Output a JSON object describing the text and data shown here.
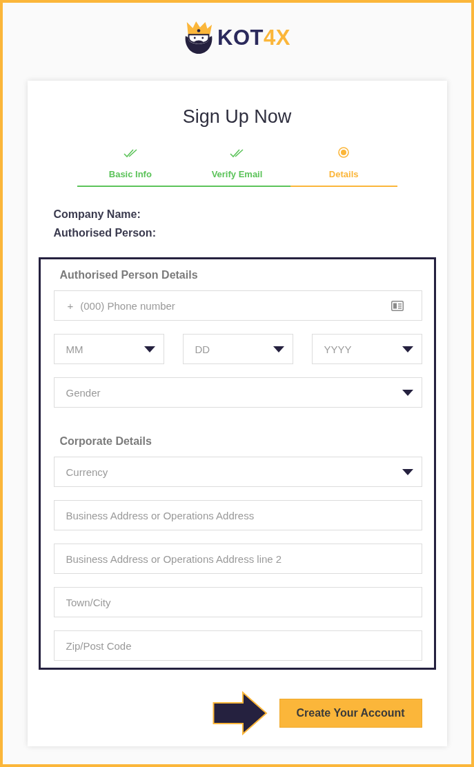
{
  "logo": {
    "text": "KOT",
    "accent": "4X"
  },
  "title": "Sign Up Now",
  "steps": [
    {
      "label": "Basic Info",
      "completed": true,
      "selected": false
    },
    {
      "label": "Verify Email",
      "completed": true,
      "selected": false
    },
    {
      "label": "Details",
      "completed": false,
      "selected": true
    }
  ],
  "summary_labels": [
    "Company Name:",
    "Authorised Person:"
  ],
  "sections": [
    {
      "heading": "Authorised Person Details",
      "fields": [
        {
          "kind": "phone",
          "prefix": "+",
          "placeholder": "(000) Phone number"
        },
        {
          "kind": "row",
          "fields": [
            {
              "kind": "select",
              "placeholder": "MM"
            },
            {
              "kind": "select",
              "placeholder": "DD"
            },
            {
              "kind": "select",
              "placeholder": "YYYY"
            }
          ]
        },
        {
          "kind": "select",
          "placeholder": "Gender"
        }
      ]
    },
    {
      "heading": "Corporate Details",
      "fields": [
        {
          "kind": "select",
          "placeholder": "Currency"
        },
        {
          "kind": "text",
          "placeholder": "Business Address or Operations Address"
        },
        {
          "kind": "text",
          "placeholder": "Business Address or Operations Address line 2"
        },
        {
          "kind": "text",
          "placeholder": "Town/City"
        },
        {
          "kind": "text",
          "placeholder": "Zip/Post Code"
        }
      ]
    }
  ],
  "submit_button": "Create Your Account"
}
